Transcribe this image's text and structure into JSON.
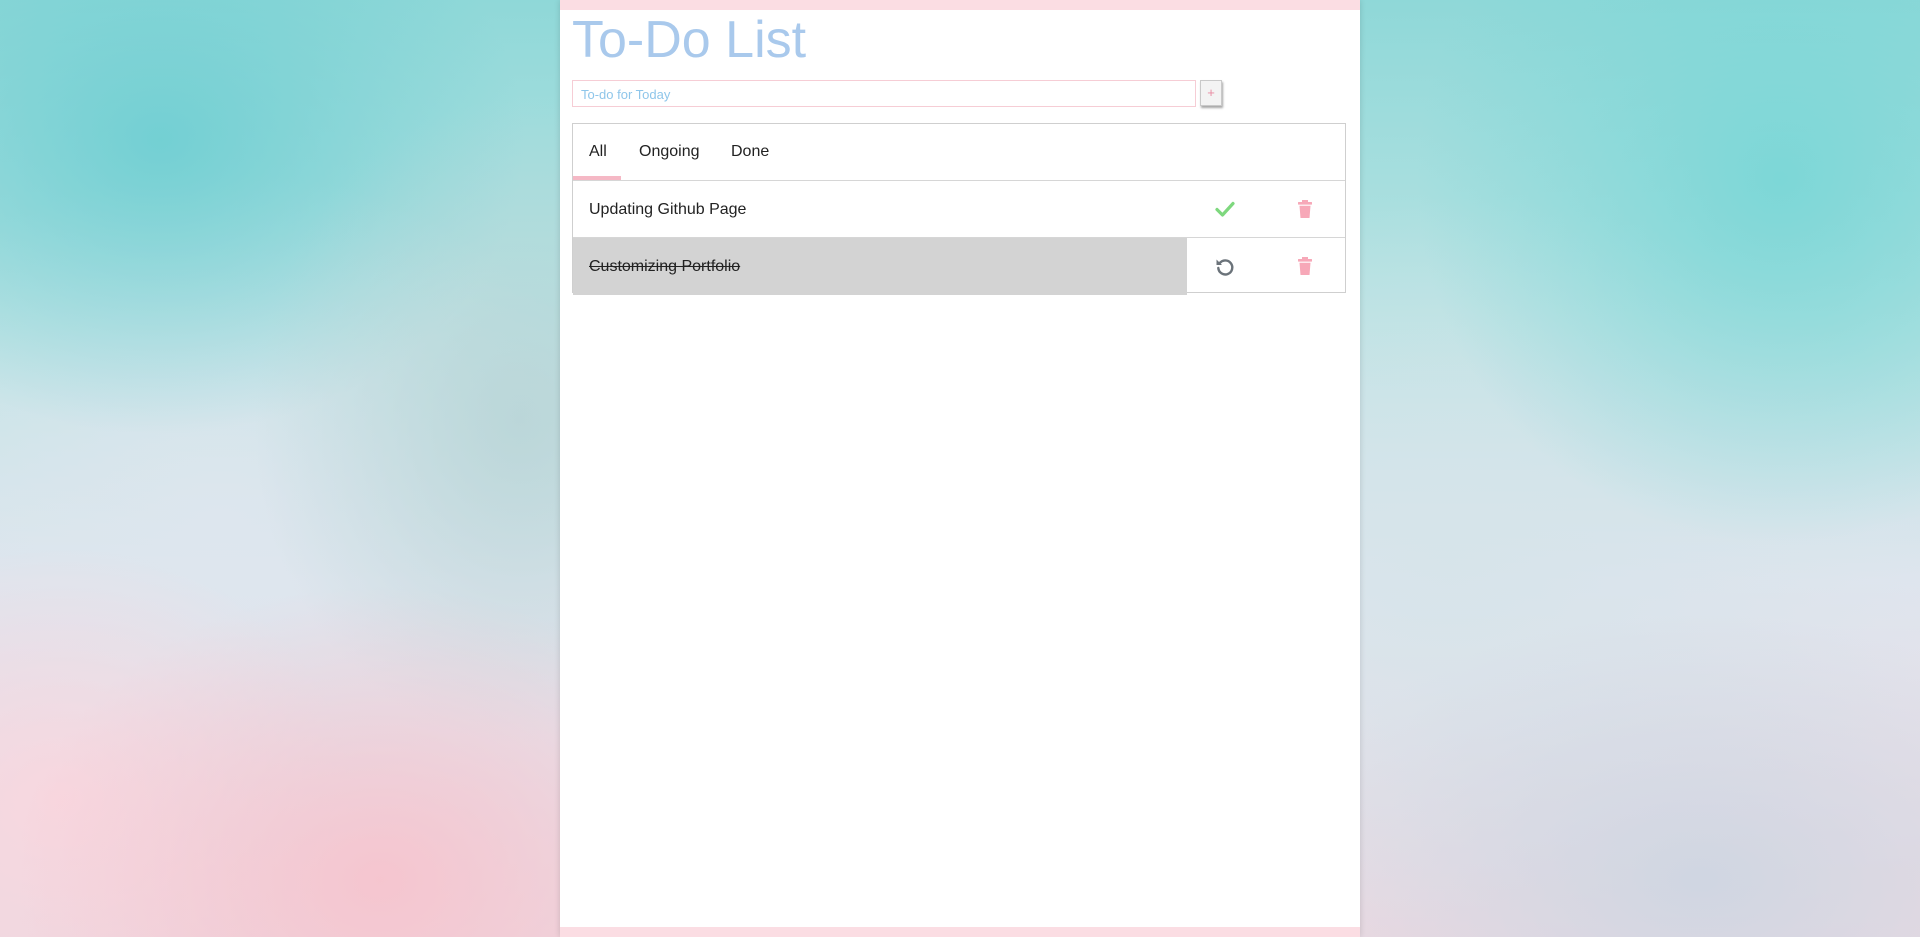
{
  "app": {
    "title": "To-Do List"
  },
  "input": {
    "placeholder": "To-do for Today",
    "value": "",
    "add_label": "+"
  },
  "tabs": [
    {
      "label": "All",
      "active": true
    },
    {
      "label": "Ongoing",
      "active": false
    },
    {
      "label": "Done",
      "active": false
    }
  ],
  "tasks": [
    {
      "text": "Updating Github Page",
      "done": false,
      "action_icon": "check-icon",
      "delete_icon": "trash-icon"
    },
    {
      "text": "Customizing Portfolio",
      "done": true,
      "action_icon": "undo-icon",
      "delete_icon": "trash-icon"
    }
  ],
  "colors": {
    "title": "#a9c9ec",
    "accent_pink": "#f5b8c5",
    "check_green": "#7ed87e",
    "trash_pink": "#f7a8b8",
    "undo_gray": "#6b737a",
    "done_row_bg": "#d3d3d3"
  }
}
